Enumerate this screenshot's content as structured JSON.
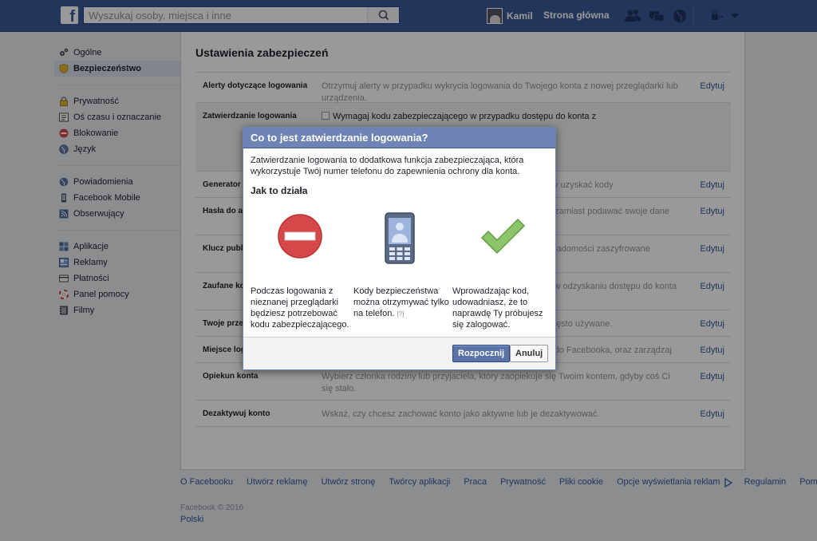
{
  "topbar": {
    "search_placeholder": "Wyszukaj osoby, miejsca i inne",
    "user_name": "Kamil",
    "home_label": "Strona główna"
  },
  "sidebar": {
    "items": [
      {
        "label": "Ogólne"
      },
      {
        "label": "Bezpieczeństwo"
      },
      {
        "label": "Prywatność"
      },
      {
        "label": "Oś czasu i oznaczanie"
      },
      {
        "label": "Blokowanie"
      },
      {
        "label": "Język"
      },
      {
        "label": "Powiadomienia"
      },
      {
        "label": "Facebook Mobile"
      },
      {
        "label": "Obserwujący"
      },
      {
        "label": "Aplikacje"
      },
      {
        "label": "Reklamy"
      },
      {
        "label": "Płatności"
      },
      {
        "label": "Panel pomocy"
      },
      {
        "label": "Filmy"
      }
    ]
  },
  "main": {
    "title": "Ustawienia zabezpieczeń",
    "edit_label": "Edytuj",
    "rows": [
      {
        "label": "Alerty dotyczące logowania",
        "desc": "Otrzymuj alerty w przypadku wykrycia logowania do Twojego konta z nowej przeglądarki lub urządzenia."
      },
      {
        "label": "Zatwierdzanie logowania",
        "desc": "Wymagaj kodu zabezpieczającego w przypadku dostępu do konta z"
      },
      {
        "label": "Generator kodów",
        "desc": "Aplikacji Facebooka na swoim telefonie możesz używać, aby uzyskać kody zabezpieczające."
      },
      {
        "label": "Hasła do aplikacji",
        "desc": "Korzystaj ze specjalnych haseł do logowania w aplikacjach, zamiast podawać swoje dane logowania."
      },
      {
        "label": "Klucz publiczny",
        "desc": "Zarządzaj kluczem OpenPGP, a Facebook będzie wysyłał wiadomości zaszyfrowane"
      },
      {
        "label": "Zaufane kontakty",
        "desc": "Wybierz przyjaciół, do których możesz się zwrócić o pomoc w odzyskaniu dostępu do konta w przypadku, gdy utracisz dostęp."
      },
      {
        "label": "Twoje przeglądarki i aplikacje",
        "desc": "Przejrzyj listę przeglądarek i aplikacji, które zapisano jako często używane."
      },
      {
        "label": "Miejsce logowania",
        "desc": "Przeglądaj i zarządzaj miejscami, z których zalogowano się do Facebooka, oraz zarządzaj nimi."
      },
      {
        "label": "Opiekun konta",
        "desc": "Wybierz członka rodziny lub przyjaciela, który zaopiekuje się Twoim kontem, gdyby coś Ci się stało."
      },
      {
        "label": "Dezaktywuj konto",
        "desc": "Wskaż, czy chcesz zachować konto jako aktywne lub je dezaktywować."
      }
    ]
  },
  "footer": {
    "links": [
      "O Facebooku",
      "Utwórz reklamę",
      "Utwórz stronę",
      "Twórcy aplikacji",
      "Praca",
      "Prywatność",
      "Pliki cookie",
      "Opcje wyświetlania reklam",
      "Regulamin",
      "Pomoc"
    ],
    "copyright": "Facebook © 2016",
    "language": "Polski"
  },
  "dialog": {
    "title": "Co to jest zatwierdzanie logowania?",
    "intro": "Zatwierdzanie logowania to dodatkowa funkcja zabezpieczająca, która wykorzystuje Twój numer telefonu do zapewnienia ochrony dla konta.",
    "subtitle": "Jak to działa",
    "col1": "Podczas logowania z nieznanej przeglądarki będziesz potrzebować kodu zabezpieczającego.",
    "col2": "Kody bezpieczeństwa można otrzymywać tylko na telefon.",
    "col2_help": "[?]",
    "col3": "Wprowadzając kod, udowadniasz, że to naprawdę Ty próbujesz się zalogować.",
    "primary_label": "Rozpocznij",
    "secondary_label": "Anuluj"
  },
  "colors": {
    "topbar": "#3b5998",
    "dialog_header": "#6d84b4",
    "link": "#365899",
    "stop_red": "#d5494a",
    "check_green": "#8cc46c"
  }
}
